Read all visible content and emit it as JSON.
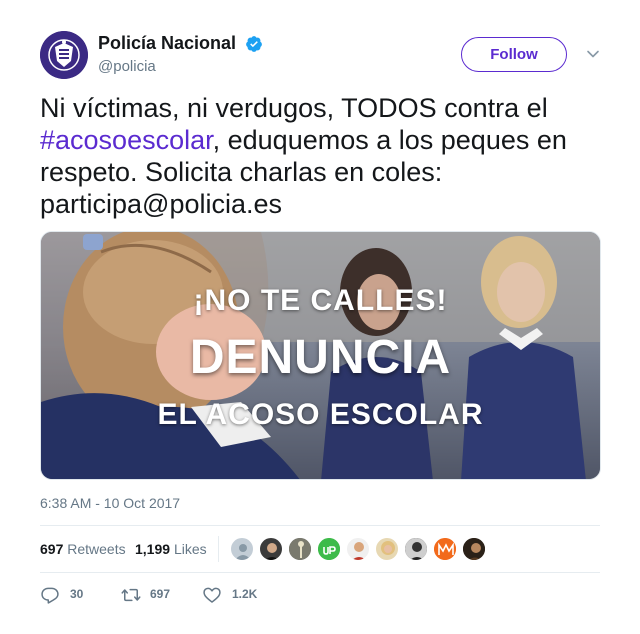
{
  "account": {
    "display_name": "Policía Nacional",
    "handle": "@policia",
    "verified": true,
    "avatar_icon": "police-badge-icon"
  },
  "follow_label": "Follow",
  "tweet": {
    "text_before": "Ni víctimas, ni verdugos, TODOS contra el ",
    "hashtag": "#acosoescolar",
    "text_after": ", eduquemos a los peques en respeto. Solicita charlas en coles: participa@policia.es"
  },
  "media": {
    "line1": "¡NO TE CALLES!",
    "line2": "DENUNCIA",
    "line3": "EL ACOSO ESCOLAR"
  },
  "timestamp": "6:38 AM - 10 Oct 2017",
  "stats": {
    "retweets_count": "697",
    "retweets_label": "Retweets",
    "likes_count": "1,199",
    "likes_label": "Likes"
  },
  "actions": {
    "replies": "30",
    "retweets": "697",
    "likes": "1.2K"
  },
  "colors": {
    "accent": "#5b2bd0",
    "verified": "#1da1f2",
    "muted": "#657786",
    "text": "#14171a"
  }
}
